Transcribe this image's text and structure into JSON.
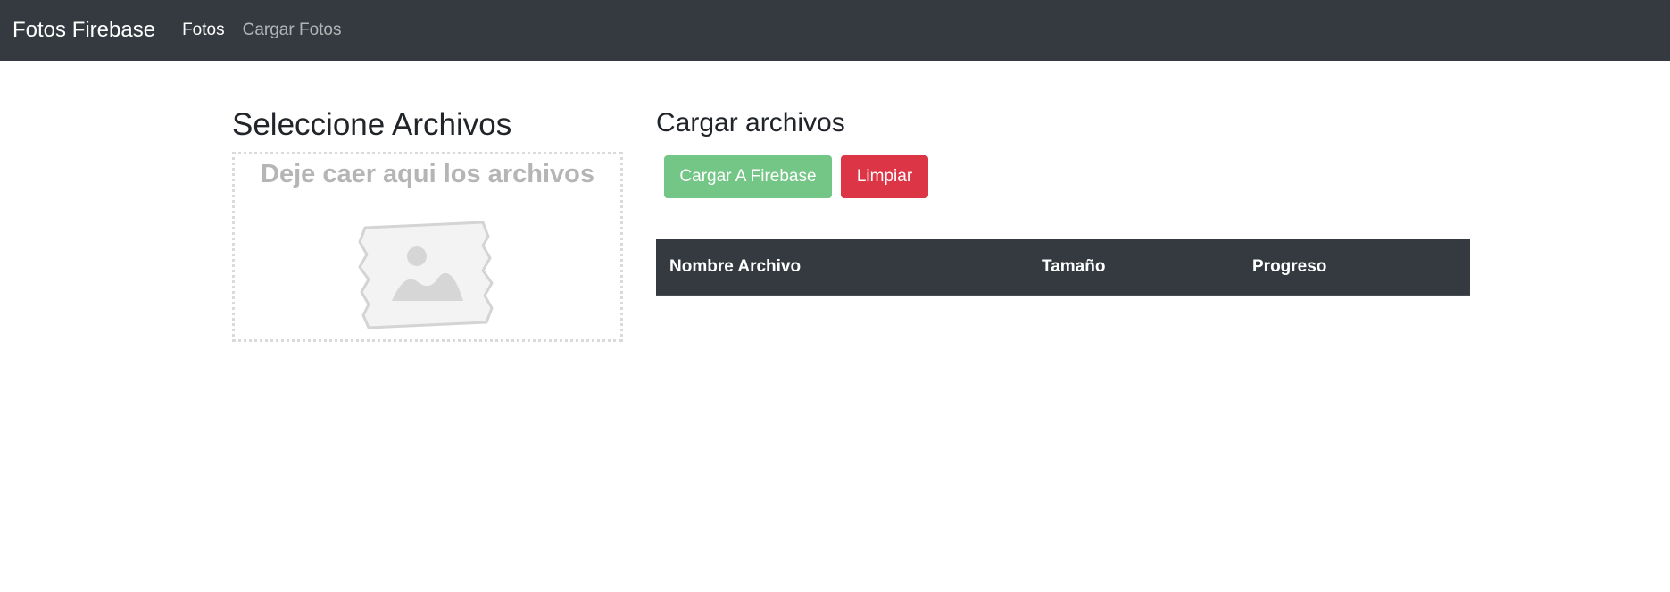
{
  "navbar": {
    "brand": "Fotos Firebase",
    "links": [
      {
        "label": "Fotos",
        "active": true
      },
      {
        "label": "Cargar Fotos",
        "active": false
      }
    ]
  },
  "left": {
    "title": "Seleccione Archivos",
    "drop_zone": {
      "text": "Deje caer aqui los archivos",
      "icon": "image-placeholder-icon"
    }
  },
  "right": {
    "title": "Cargar archivos",
    "buttons": {
      "upload_label": "Cargar A Firebase",
      "clear_label": "Limpiar"
    },
    "table": {
      "headers": [
        "Nombre Archivo",
        "Tamaño",
        "Progreso"
      ],
      "rows": []
    }
  },
  "colors": {
    "navbar_bg": "#343a40",
    "success": "#74c687",
    "danger": "#dc3545",
    "table_header_bg": "#343a40",
    "drop_text": "#b5b5b5"
  }
}
